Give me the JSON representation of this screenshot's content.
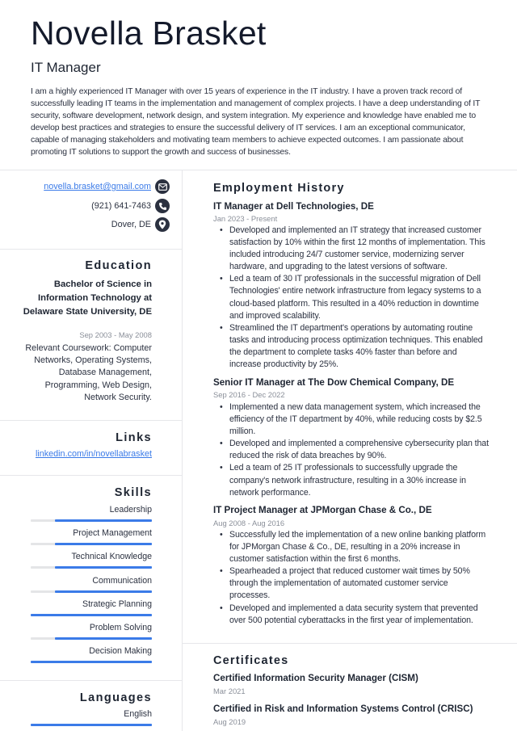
{
  "header": {
    "name": "Novella Brasket",
    "title": "IT Manager",
    "summary": "I am a highly experienced IT Manager with over 15 years of experience in the IT industry. I have a proven track record of successfully leading IT teams in the implementation and management of complex projects. I have a deep understanding of IT security, software development, network design, and system integration. My experience and knowledge have enabled me to develop best practices and strategies to ensure the successful delivery of IT services. I am an exceptional communicator, capable of managing stakeholders and motivating team members to achieve expected outcomes. I am passionate about promoting IT solutions to support the growth and success of businesses."
  },
  "contact": {
    "email": "novella.brasket@gmail.com",
    "phone": "(921) 641-7463",
    "location": "Dover, DE",
    "icons": [
      "envelope-icon",
      "phone-icon",
      "map-pin-icon"
    ]
  },
  "education": {
    "heading": "Education",
    "degree": "Bachelor of Science in Information Technology at Delaware State University, DE",
    "dates": "Sep 2003 - May 2008",
    "description": "Relevant Coursework: Computer Networks, Operating Systems, Database Management, Programming, Web Design, Network Security."
  },
  "links": {
    "heading": "Links",
    "items": [
      {
        "label": "linkedin.com/in/novellabrasket"
      }
    ]
  },
  "skills": {
    "heading": "Skills",
    "items": [
      {
        "label": "Leadership",
        "level": 0.8
      },
      {
        "label": "Project Management",
        "level": 0.8
      },
      {
        "label": "Technical Knowledge",
        "level": 0.8
      },
      {
        "label": "Communication",
        "level": 0.8
      },
      {
        "label": "Strategic Planning",
        "level": 1.0
      },
      {
        "label": "Problem Solving",
        "level": 0.8
      },
      {
        "label": "Decision Making",
        "level": 1.0
      }
    ]
  },
  "languages": {
    "heading": "Languages",
    "items": [
      {
        "label": "English",
        "level": 1.0
      }
    ]
  },
  "employment": {
    "heading": "Employment History",
    "jobs": [
      {
        "title": "IT Manager at Dell Technologies, DE",
        "dates": "Jan 2023 - Present",
        "bullets": [
          "Developed and implemented an IT strategy that increased customer satisfaction by 10% within the first 12 months of implementation. This included introducing 24/7 customer service, modernizing server hardware, and upgrading to the latest versions of software.",
          "Led a team of 30 IT professionals in the successful migration of Dell Technologies' entire network infrastructure from legacy systems to a cloud-based platform. This resulted in a 40% reduction in downtime and improved scalability.",
          "Streamlined the IT department's operations by automating routine tasks and introducing process optimization techniques. This enabled the department to complete tasks 40% faster than before and increase productivity by 25%."
        ]
      },
      {
        "title": "Senior IT Manager at The Dow Chemical Company, DE",
        "dates": "Sep 2016 - Dec 2022",
        "bullets": [
          "Implemented a new data management system, which increased the efficiency of the IT department by 40%, while reducing costs by $2.5 million.",
          "Developed and implemented a comprehensive cybersecurity plan that reduced the risk of data breaches by 90%.",
          "Led a team of 25 IT professionals to successfully upgrade the company's network infrastructure, resulting in a 30% increase in network performance."
        ]
      },
      {
        "title": "IT Project Manager at JPMorgan Chase & Co., DE",
        "dates": "Aug 2008 - Aug 2016",
        "bullets": [
          "Successfully led the implementation of a new online banking platform for JPMorgan Chase & Co., DE, resulting in a 20% increase in customer satisfaction within the first 6 months.",
          "Spearheaded a project that reduced customer wait times by 50% through the implementation of automated customer service processes.",
          "Developed and implemented a data security system that prevented over 500 potential cyberattacks in the first year of implementation."
        ]
      }
    ]
  },
  "certificates": {
    "heading": "Certificates",
    "items": [
      {
        "name": "Certified Information Security Manager (CISM)",
        "date": "Mar 2021"
      },
      {
        "name": "Certified in Risk and Information Systems Control (CRISC)",
        "date": "Aug 2019"
      }
    ]
  },
  "colors": {
    "accent": "#3b7be8",
    "text": "#1e2532",
    "muted": "#8a8f99",
    "divider": "#e6e7ea"
  }
}
